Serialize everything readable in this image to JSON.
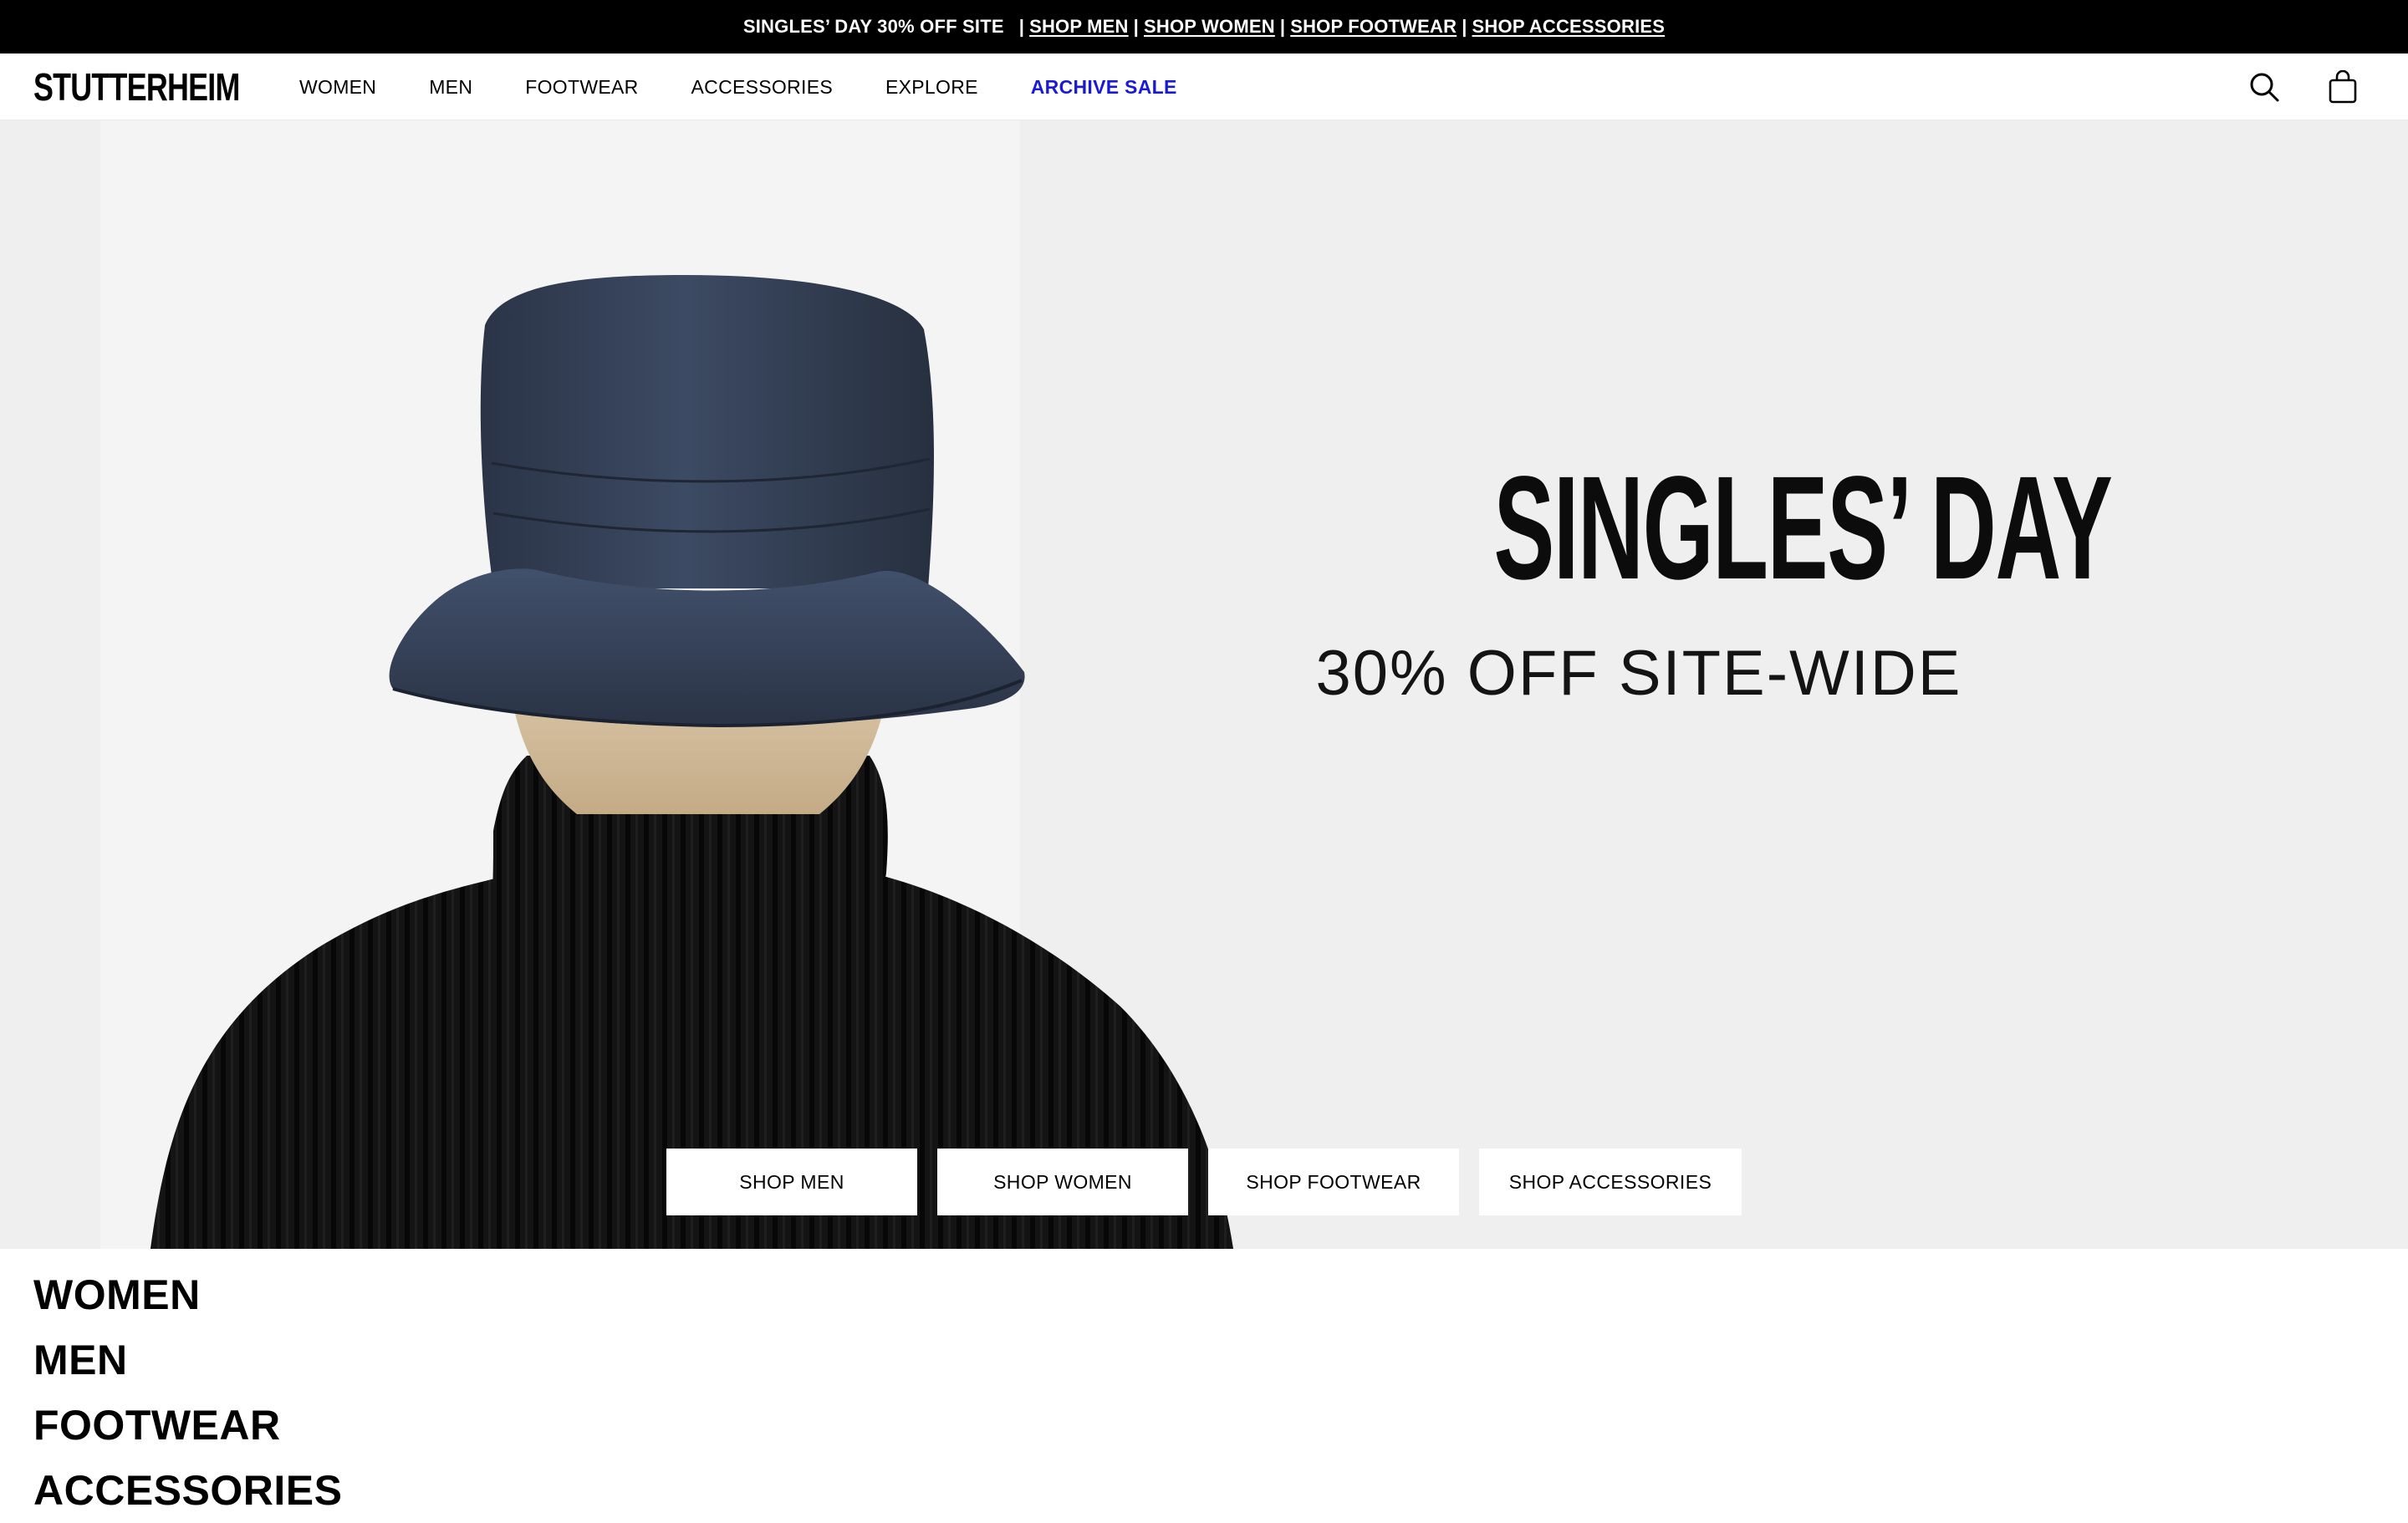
{
  "announcement": {
    "lead": "SINGLES’ DAY 30% OFF SITE",
    "sep": "|",
    "links": [
      "SHOP MEN",
      "SHOP WOMEN",
      "SHOP FOOTWEAR",
      "SHOP ACCESSORIES"
    ]
  },
  "header": {
    "logo": "STUTTERHEIM",
    "nav": [
      "WOMEN",
      "MEN",
      "FOOTWEAR",
      "ACCESSORIES",
      "EXPLORE",
      "ARCHIVE SALE"
    ],
    "sale_color": "#1a1ad6",
    "icons": [
      "search-icon",
      "shopping-bag-icon"
    ]
  },
  "hero": {
    "title": "SINGLES’ DAY",
    "subtitle": "30% OFF SITE-WIDE",
    "ctas": [
      "SHOP MEN",
      "SHOP WOMEN",
      "SHOP FOOTWEAR",
      "SHOP ACCESSORIES"
    ],
    "background": "#efefef"
  },
  "categories": [
    "WOMEN",
    "MEN",
    "FOOTWEAR",
    "ACCESSORIES"
  ]
}
